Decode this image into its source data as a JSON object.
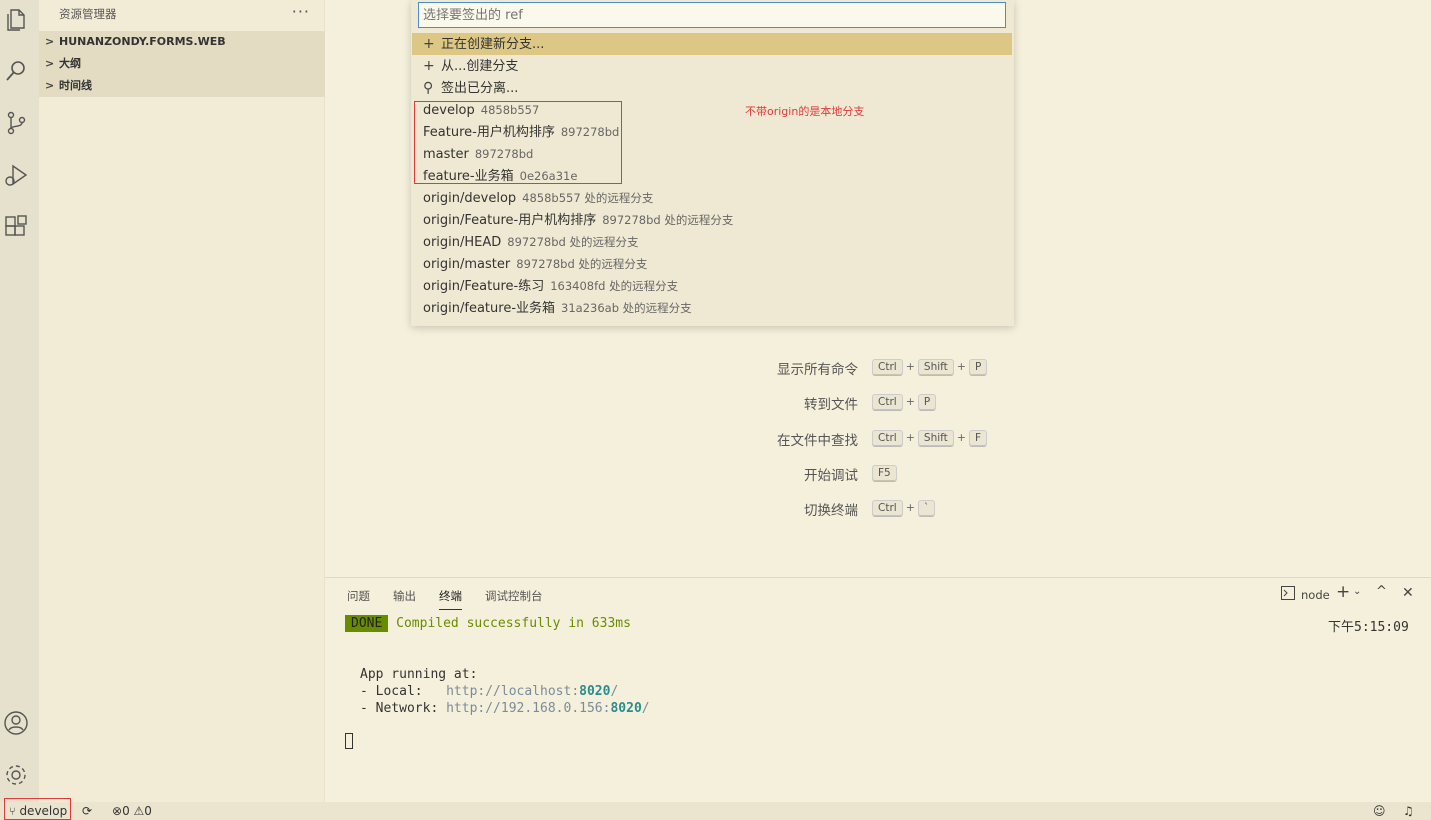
{
  "sidebar": {
    "title": "资源管理器",
    "more": "···",
    "sections": [
      {
        "label": "HUNANZONDY.FORMS.WEB"
      },
      {
        "label": "大纲"
      },
      {
        "label": "时间线"
      }
    ]
  },
  "quick_pick": {
    "placeholder": "选择要签出的 ref",
    "actions": [
      {
        "icon": "+",
        "label": "正在创建新分支..."
      },
      {
        "icon": "+",
        "label": "从...创建分支"
      },
      {
        "icon": "⚲",
        "label": "签出已分离..."
      }
    ],
    "branches": [
      {
        "name": "develop",
        "desc": "4858b557"
      },
      {
        "name": "Feature-用户机构排序",
        "desc": "897278bd"
      },
      {
        "name": "master",
        "desc": "897278bd"
      },
      {
        "name": "feature-业务箱",
        "desc": "0e26a31e"
      },
      {
        "name": "origin/develop",
        "desc": "4858b557 处的远程分支"
      },
      {
        "name": "origin/Feature-用户机构排序",
        "desc": "897278bd 处的远程分支"
      },
      {
        "name": "origin/HEAD",
        "desc": "897278bd 处的远程分支"
      },
      {
        "name": "origin/master",
        "desc": "897278bd 处的远程分支"
      },
      {
        "name": "origin/Feature-练习",
        "desc": "163408fd 处的远程分支"
      },
      {
        "name": "origin/feature-业务箱",
        "desc": "31a236ab 处的远程分支"
      }
    ],
    "note": "不带origin的是本地分支"
  },
  "shortcuts": [
    {
      "label": "显示所有命令",
      "keys": [
        "Ctrl",
        "Shift",
        "P"
      ]
    },
    {
      "label": "转到文件",
      "keys": [
        "Ctrl",
        "P"
      ]
    },
    {
      "label": "在文件中查找",
      "keys": [
        "Ctrl",
        "Shift",
        "F"
      ]
    },
    {
      "label": "开始调试",
      "keys": [
        "F5"
      ]
    },
    {
      "label": "切换终端",
      "keys": [
        "Ctrl",
        "`"
      ]
    }
  ],
  "panel": {
    "tabs": [
      "问题",
      "输出",
      "终端",
      "调试控制台"
    ],
    "terminal_name": "node",
    "time": "下午5:15:09",
    "done": "DONE",
    "compiled": "Compiled successfully in 633ms",
    "app_running": "App running at:",
    "local_label": "- Local:   ",
    "local_url": "http://localhost:",
    "local_port": "8020",
    "local_tail": "/",
    "network_label": "- Network: ",
    "network_url": "http://192.168.0.156:",
    "network_port": "8020",
    "network_tail": "/"
  },
  "status_bar": {
    "branch": "develop",
    "errors": "0",
    "warnings": "0"
  }
}
